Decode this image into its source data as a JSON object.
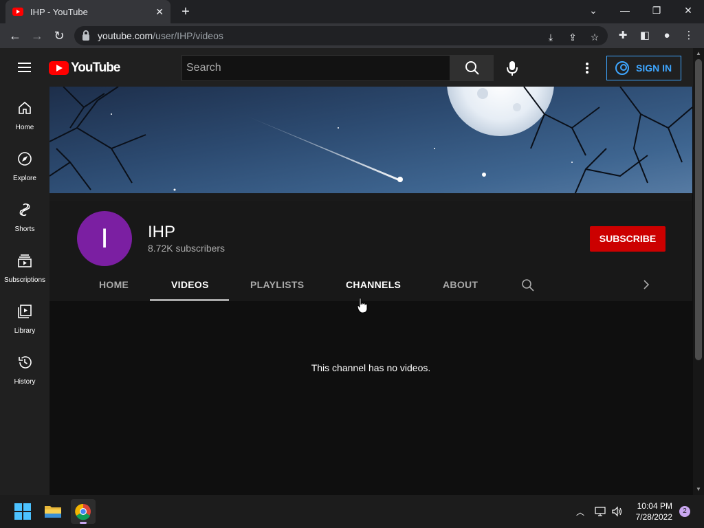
{
  "browser": {
    "tab_title": "IHP - YouTube",
    "tab_close": "✕",
    "new_tab": "+",
    "url_host": "youtube.com",
    "url_path": "/user/IHP/videos"
  },
  "yt": {
    "logo_text": "YouTube",
    "search_placeholder": "Search",
    "sign_in": "SIGN IN"
  },
  "guide": {
    "items": [
      {
        "label": "Home",
        "icon": "home-icon"
      },
      {
        "label": "Explore",
        "icon": "compass-icon"
      },
      {
        "label": "Shorts",
        "icon": "shorts-icon"
      },
      {
        "label": "Subscriptions",
        "icon": "subscriptions-icon"
      },
      {
        "label": "Library",
        "icon": "library-icon"
      },
      {
        "label": "History",
        "icon": "history-icon"
      }
    ]
  },
  "channel": {
    "avatar_letter": "I",
    "avatar_color": "#7b1fa2",
    "name": "IHP",
    "subscribers": "8.72K subscribers",
    "subscribe": "SUBSCRIBE",
    "tabs": [
      "HOME",
      "VIDEOS",
      "PLAYLISTS",
      "CHANNELS",
      "ABOUT"
    ],
    "active_tab": "VIDEOS",
    "empty_message": "This channel has no videos."
  },
  "taskbar": {
    "time": "10:04 PM",
    "date": "7/28/2022",
    "notifications": "2"
  },
  "colors": {
    "accent_blue": "#3ea6ff",
    "subscribe_red": "#cc0000",
    "youtube_red": "#ff0000"
  }
}
